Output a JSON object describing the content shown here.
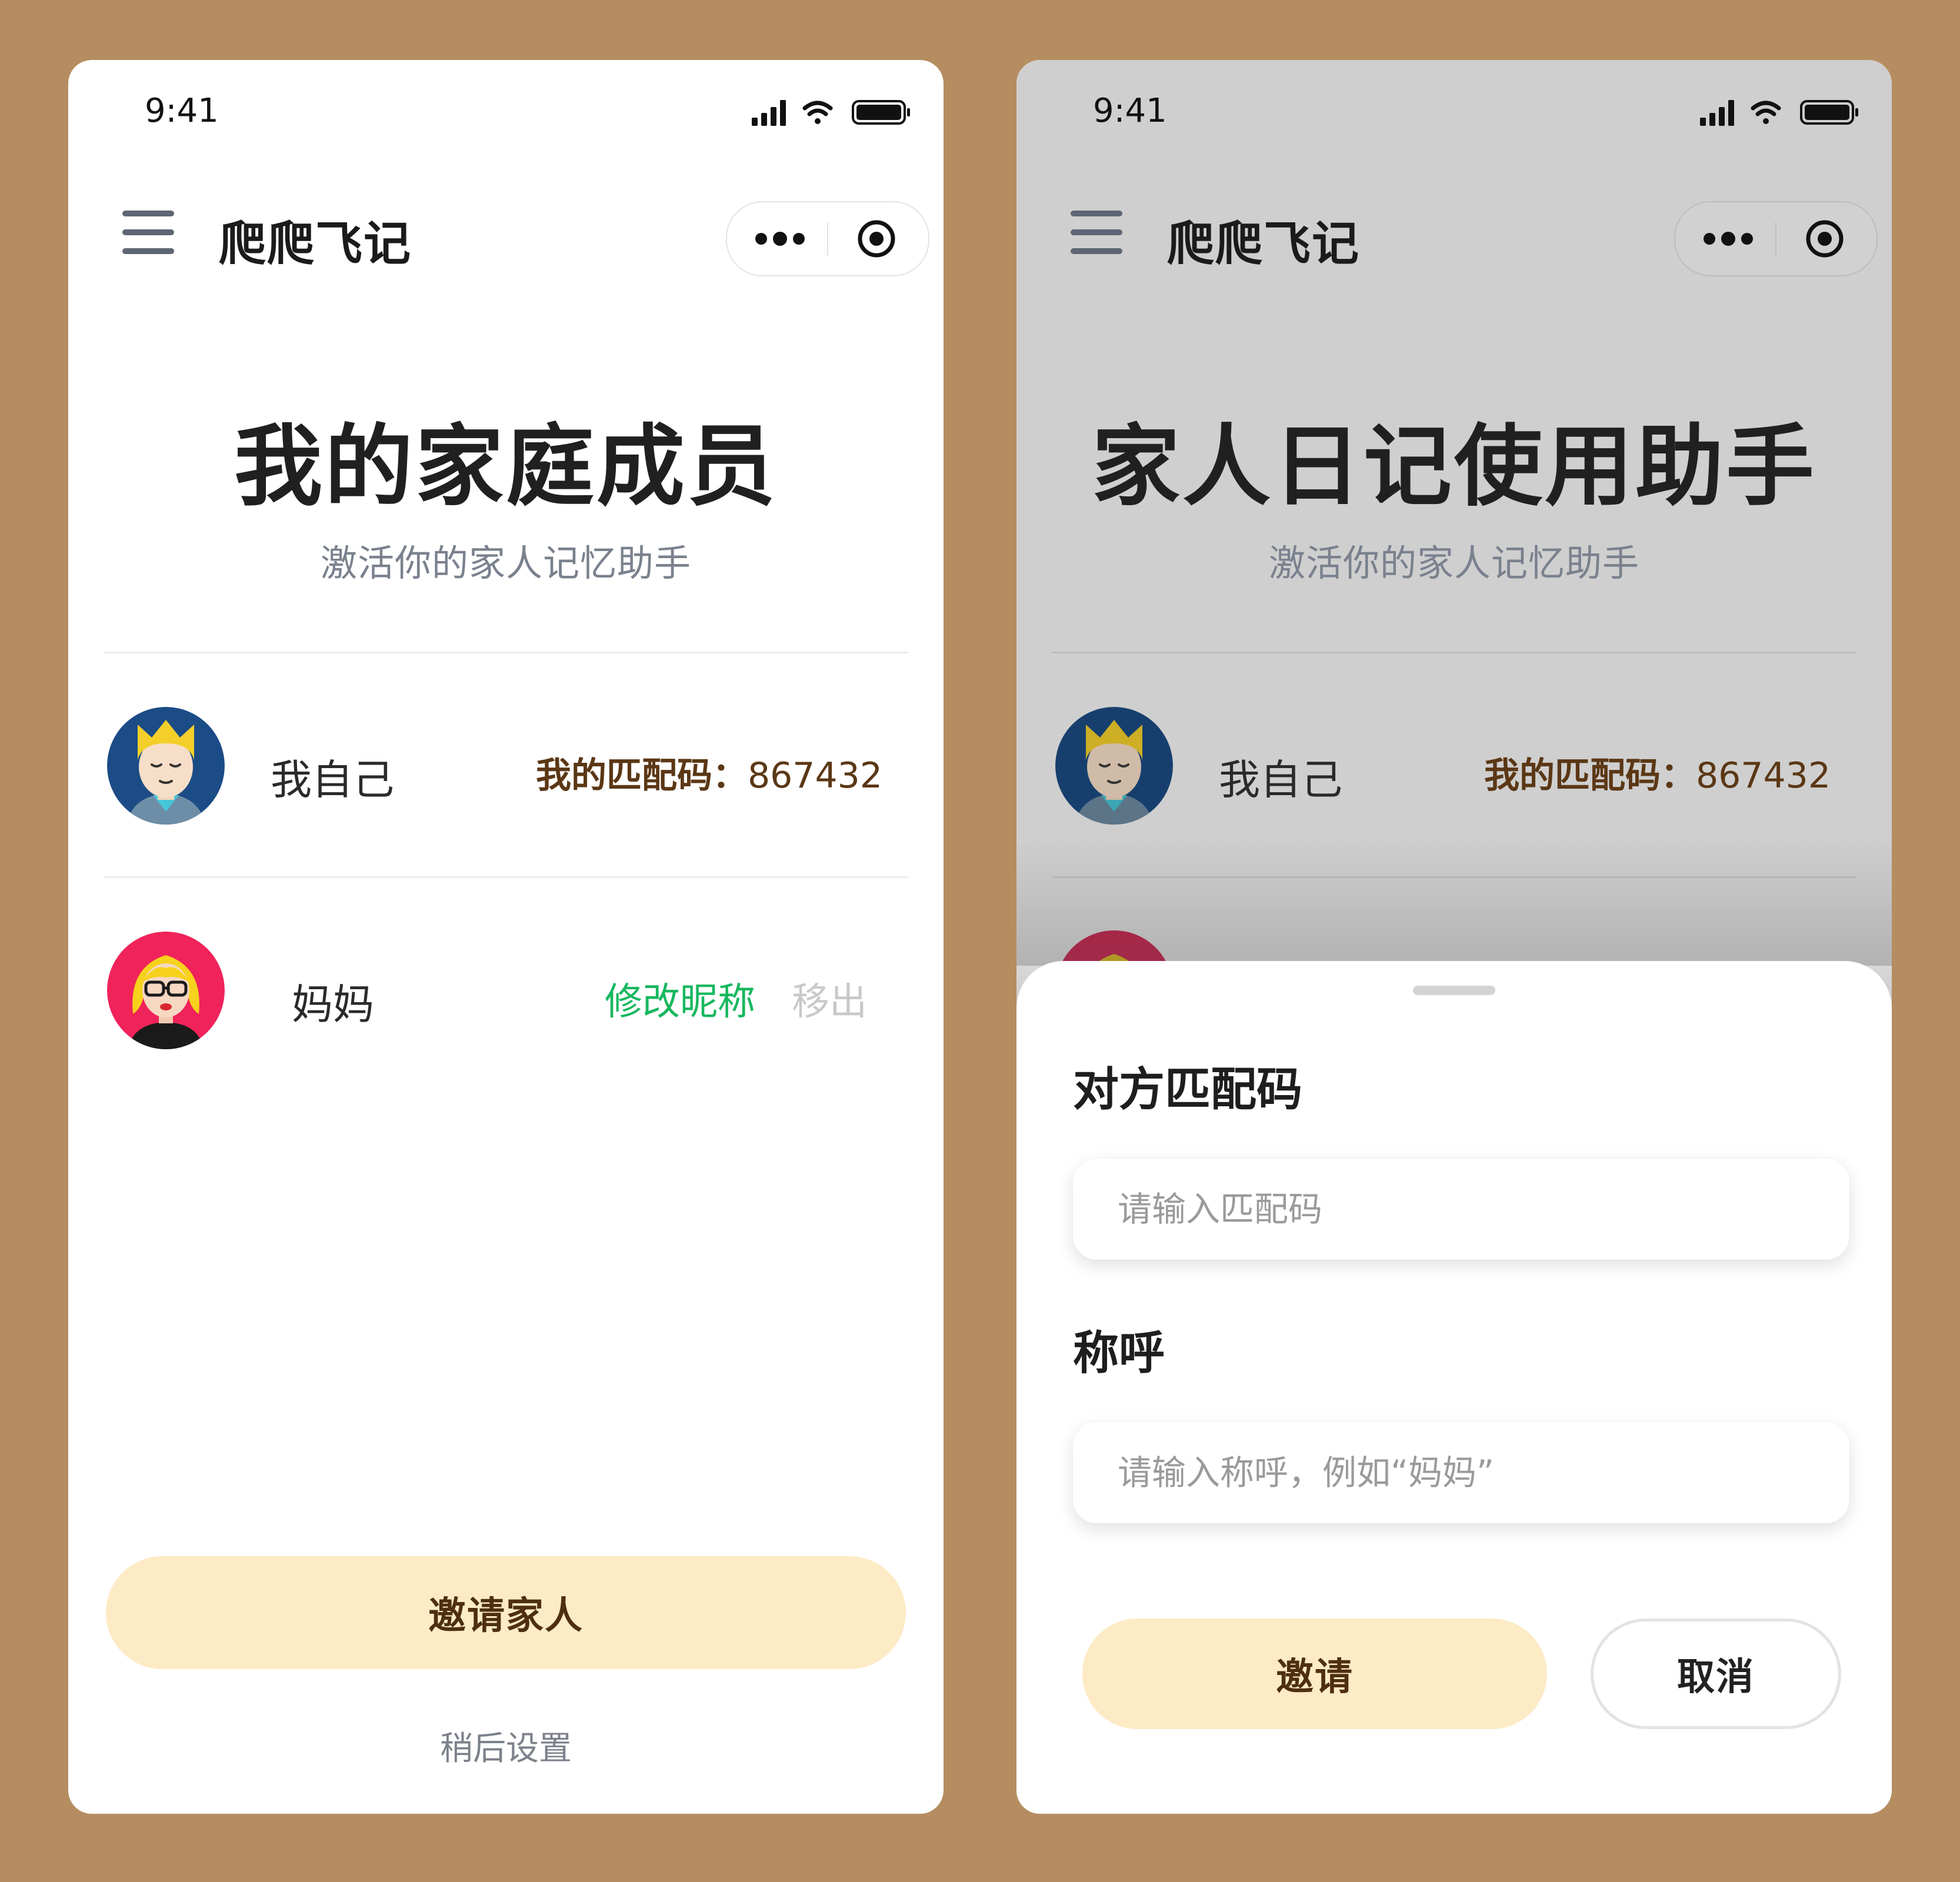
{
  "colors": {
    "background": "#B58D61",
    "accent_button": "#FDEBC6",
    "button_text": "#4E2F10",
    "match_code": "#5B3715",
    "rename_green": "#17B75E",
    "muted": "#7A818E",
    "dim_overlay": "#CFCFCF"
  },
  "left_screen": {
    "status_time": "9:41",
    "app_name": "爬爬飞记",
    "title": "我的家庭成员",
    "subtitle": "激活你的家人记忆助手",
    "members": [
      {
        "name": "我自己",
        "avatar": "man-avatar-icon",
        "match_code_label": "我的匹配码：",
        "match_code": "867432"
      },
      {
        "name": "妈妈",
        "avatar": "woman-avatar-icon",
        "rename_label": "修改昵称",
        "remove_label": "移出"
      }
    ],
    "invite_button": "邀请家人",
    "later_link": "稍后设置"
  },
  "right_screen": {
    "status_time": "9:41",
    "app_name": "爬爬飞记",
    "title": "家人日记使用助手",
    "subtitle": "激活你的家人记忆助手",
    "self_member": {
      "name": "我自己",
      "match_code_label": "我的匹配码：",
      "match_code": "867432"
    },
    "sheet": {
      "code_label": "对方匹配码",
      "code_placeholder": "请输入匹配码",
      "nickname_label": "称呼",
      "nickname_placeholder": "请输入称呼，例如“妈妈”",
      "invite_button": "邀请",
      "cancel_button": "取消"
    }
  }
}
